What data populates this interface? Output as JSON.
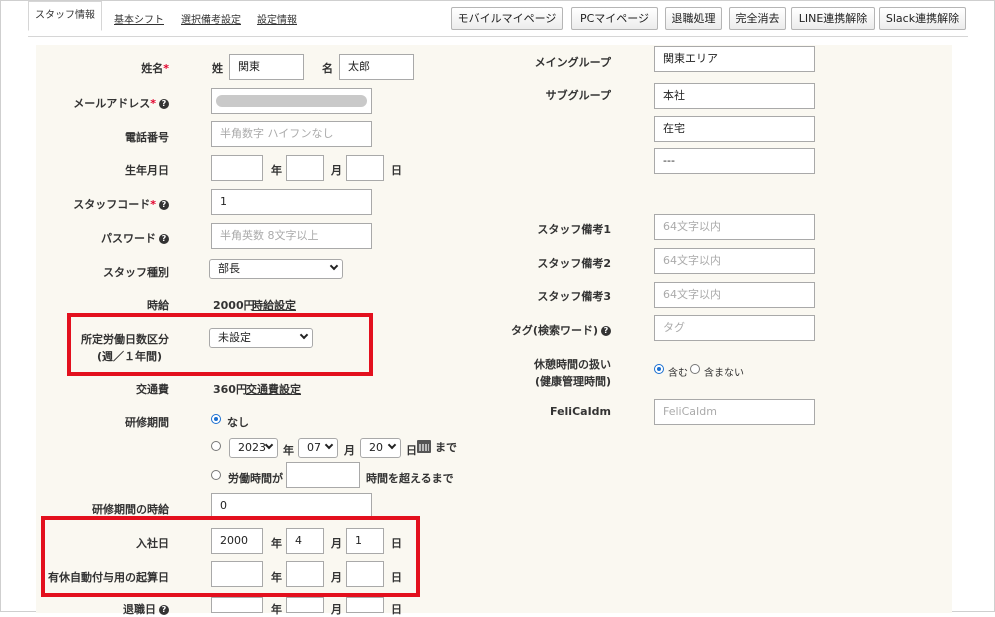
{
  "tabs": [
    "スタッフ情報",
    "基本シフト",
    "選択備考設定",
    "設定情報"
  ],
  "buttons": [
    "モバイルマイページ",
    "PCマイページ",
    "退職処理",
    "完全消去",
    "LINE連携解除",
    "Slack連携解除"
  ],
  "name": {
    "label": "姓名",
    "sei_label": "姓",
    "sei": "関東",
    "mei_label": "名",
    "mei": "太郎"
  },
  "email": {
    "label": "メールアドレス"
  },
  "phone": {
    "label": "電話番号",
    "placeholder": "半角数字 ハイフンなし"
  },
  "birthday": {
    "label": "生年月日",
    "year_unit": "年",
    "month_unit": "月",
    "day_unit": "日"
  },
  "staff_code": {
    "label": "スタッフコード",
    "value": "1"
  },
  "password": {
    "label": "パスワード",
    "placeholder": "半角英数 8文字以上"
  },
  "staff_type": {
    "label": "スタッフ種別",
    "value": "部長"
  },
  "hourly": {
    "label": "時給",
    "value": "2000円",
    "link": "時給設定"
  },
  "work_days": {
    "label_line1": "所定労働日数区分",
    "label_line2": "(週／１年間)",
    "value": "未設定"
  },
  "transport": {
    "label": "交通費",
    "value": "360円",
    "link": "交通費設定"
  },
  "training": {
    "label": "研修期間",
    "opt_none": "なし",
    "year": "2023",
    "year_unit": "年",
    "month": "07",
    "month_unit": "月",
    "day": "20",
    "day_unit": "日",
    "until": "まで",
    "opt_hours_prefix": "労働時間が",
    "opt_hours_suffix": "時間を超えるまで"
  },
  "training_wage": {
    "label": "研修期間の時給",
    "value": "0"
  },
  "hire_date": {
    "label": "入社日",
    "year": "2000",
    "month": "4",
    "day": "1",
    "year_unit": "年",
    "month_unit": "月",
    "day_unit": "日"
  },
  "leave_base": {
    "label": "有休自動付与用の起算日",
    "year_unit": "年",
    "month_unit": "月",
    "day_unit": "日"
  },
  "retire_date": {
    "label": "退職日",
    "year_unit": "年",
    "month_unit": "月",
    "day_unit": "日"
  },
  "main_group": {
    "label": "メイングループ",
    "value": "関東エリア"
  },
  "sub_group": {
    "label": "サブグループ",
    "values": [
      "本社",
      "在宅",
      "---"
    ]
  },
  "notes": [
    {
      "label": "スタッフ備考1",
      "placeholder": "64文字以内"
    },
    {
      "label": "スタッフ備考2",
      "placeholder": "64文字以内"
    },
    {
      "label": "スタッフ備考3",
      "placeholder": "64文字以内"
    }
  ],
  "tag": {
    "label": "タグ(検索ワード)",
    "placeholder": "タグ"
  },
  "break_time": {
    "label_line1": "休憩時間の扱い",
    "label_line2": "(健康管理時間)",
    "opt_include": "含む",
    "opt_exclude": "含まない"
  },
  "felica": {
    "label": "FeliCaIdm",
    "placeholder": "FeliCaIdm"
  },
  "colors": {
    "accent_red": "#e3101e",
    "required": "#e2002b",
    "radio": "#1a6fd1",
    "panel": "#faf8f1"
  }
}
